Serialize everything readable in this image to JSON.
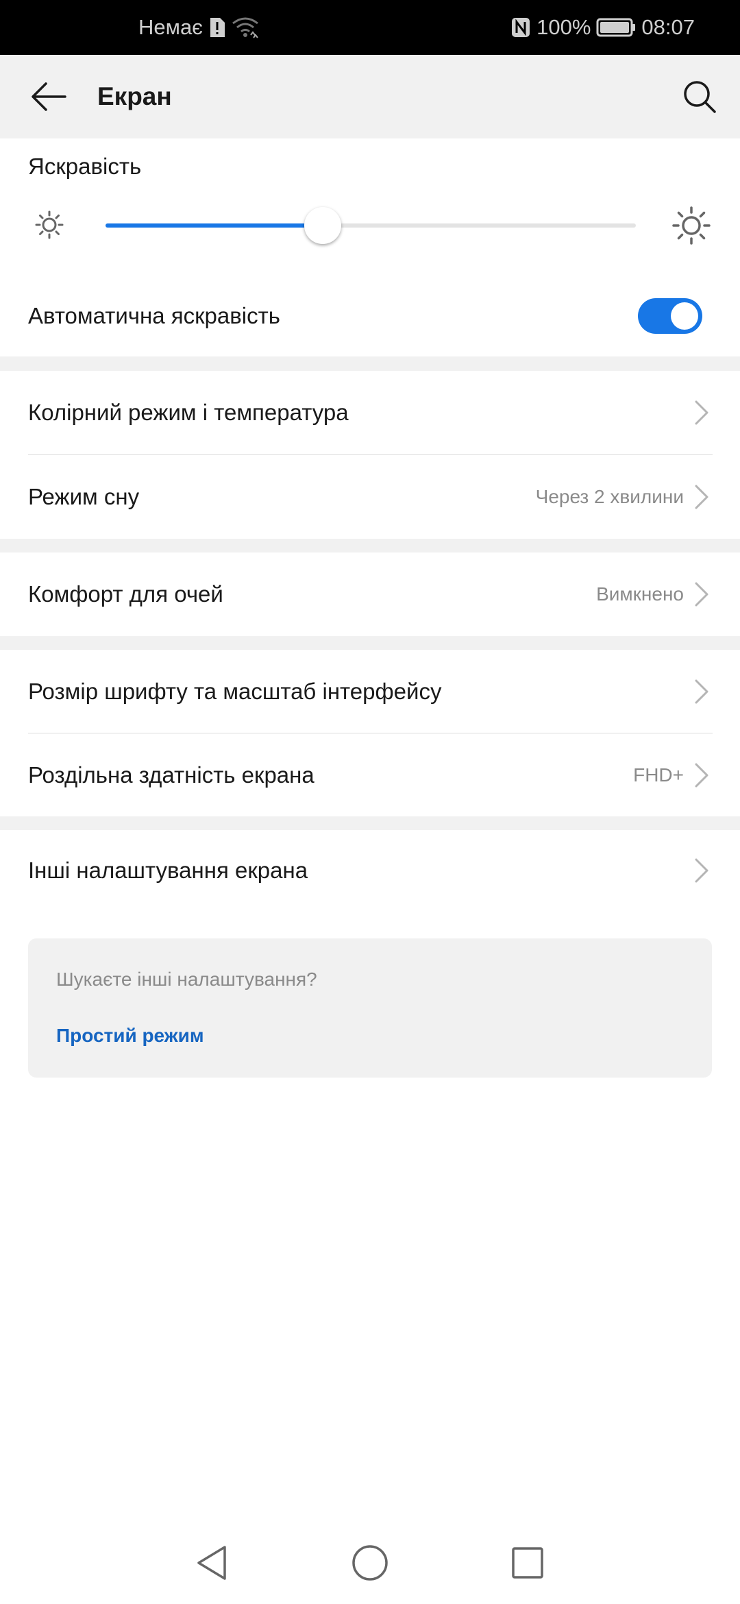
{
  "status_bar": {
    "carrier": "Немає",
    "battery_percent": "100%",
    "time": "08:07",
    "icons": [
      "sim-alert-icon",
      "wifi-icon",
      "nfc-icon",
      "battery-icon"
    ]
  },
  "app_bar": {
    "title": "Екран",
    "icons": [
      "back-arrow-icon",
      "search-icon"
    ]
  },
  "brightness": {
    "label": "Яскравість",
    "level_fraction": 0.41,
    "accent_color": "#1877e6",
    "icons": [
      "brightness-low-icon",
      "brightness-high-icon"
    ]
  },
  "auto_brightness": {
    "label": "Автоматична яскравість",
    "enabled": true
  },
  "settings": {
    "color_mode": {
      "label": "Колірний режим і температура",
      "value": ""
    },
    "sleep": {
      "label": "Режим сну",
      "value": "Через 2 хвилини"
    },
    "eye_comfort": {
      "label": "Комфорт для очей",
      "value": "Вимкнено"
    },
    "font_size": {
      "label": "Розмір шрифту та масштаб інтерфейсу",
      "value": ""
    },
    "resolution": {
      "label": "Роздільна здатність екрана",
      "value": "FHD+"
    },
    "other": {
      "label": "Інші налаштування екрана",
      "value": ""
    }
  },
  "suggestion": {
    "question": "Шукаєте інші налаштування?",
    "link": "Простий режим",
    "link_color": "#1665c1"
  },
  "nav_bar": {
    "icons": [
      "nav-back-icon",
      "nav-home-icon",
      "nav-recents-icon"
    ]
  }
}
